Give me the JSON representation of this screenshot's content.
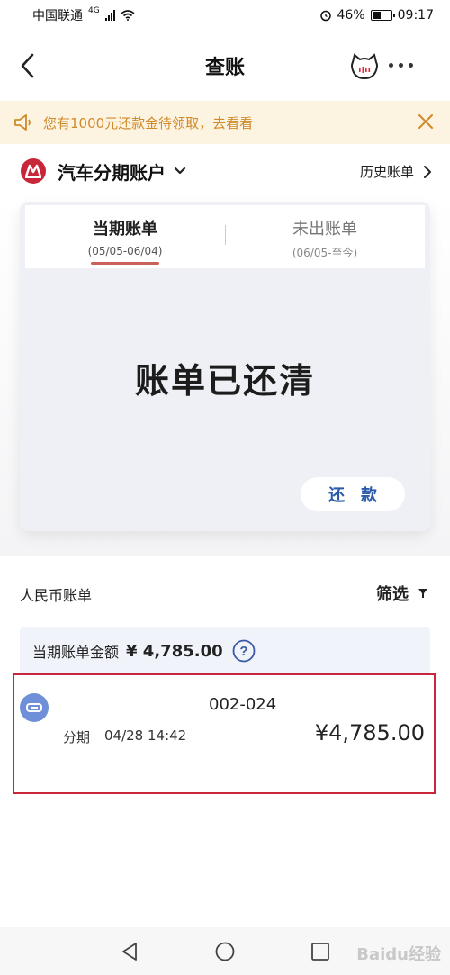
{
  "status_bar": {
    "carrier": "中国联通",
    "network": "4G",
    "battery": "46%",
    "battery_level": 0.46,
    "time": "09:17"
  },
  "nav": {
    "title": "查账"
  },
  "notice": {
    "text": "您有1000元还款金待领取，去看看"
  },
  "account": {
    "name": "汽车分期账户",
    "history_label": "历史账单"
  },
  "bill_card": {
    "tabs": [
      {
        "label": "当期账单",
        "date": "(05/05-06/04)"
      },
      {
        "label": "未出账单",
        "date": "(06/05-至今)"
      }
    ],
    "status": "账单已还清",
    "repay_label": "还款"
  },
  "sheet": {
    "currency_label": "人民币账单",
    "filter_label": "筛选",
    "summary_label": "当期账单金额",
    "summary_amount": "¥ 4,785.00",
    "transaction": {
      "description": "002-024",
      "type": "分期",
      "time": "04/28 14:42",
      "amount": "¥4,785.00"
    }
  },
  "watermark": "Baidu经验",
  "colors": {
    "accent_red": "#c8263a",
    "tab_underline": "#c9625a",
    "link_blue": "#2a5aa8",
    "notice_bg": "#fdf3e1",
    "notice_text": "#d08a2a"
  }
}
